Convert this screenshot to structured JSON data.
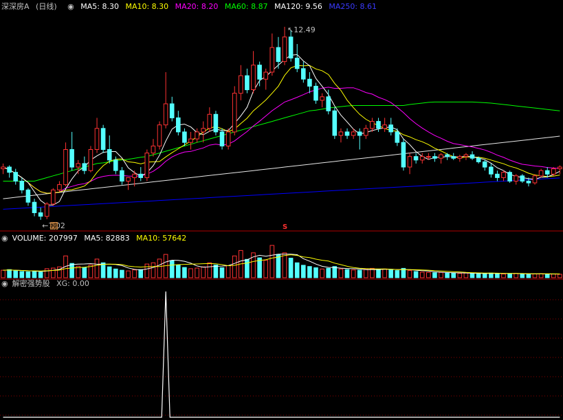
{
  "price_panel": {
    "title": "深深房A",
    "period": "(日线)",
    "ma": [
      {
        "label": "MA5: 8.30",
        "color": "#ffffff"
      },
      {
        "label": "MA10: 8.30",
        "color": "#ffff00"
      },
      {
        "label": "MA20: 8.20",
        "color": "#ff00ff"
      },
      {
        "label": "MA60: 8.87",
        "color": "#00ff00"
      },
      {
        "label": "MA120: 9.56",
        "color": "#ffffff"
      },
      {
        "label": "MA250: 8.61",
        "color": "#0000ff"
      }
    ],
    "high_label": "12.49",
    "low_label": "7.02",
    "marker_bang": "榜",
    "marker_s": "S"
  },
  "volume_panel": {
    "title": "VOLUME: 207997",
    "ma5": "MA5: 82883",
    "ma10": "MA10: 57642"
  },
  "indicator_panel": {
    "title": "解密强势股",
    "xg": "XG: 0.00"
  },
  "colors": {
    "up": "#ff3232",
    "down": "#54ffff",
    "grid": "#8b0000",
    "ma5": "#ffffff",
    "ma10": "#ffff00",
    "ma20": "#ff00ff",
    "ma60": "#00ff00",
    "ma120": "#e8e8e8",
    "ma250": "#0000ff"
  },
  "chart_data": {
    "type": "candlestick",
    "price_ylim": [
      6.8,
      12.9
    ],
    "volume_ylim": [
      0,
      230000
    ],
    "candles": [
      [
        8.45,
        8.6,
        8.3,
        8.5
      ],
      [
        8.5,
        8.55,
        8.2,
        8.35
      ],
      [
        8.35,
        8.45,
        8.0,
        8.1
      ],
      [
        8.1,
        8.2,
        7.75,
        7.85
      ],
      [
        7.85,
        7.9,
        7.4,
        7.5
      ],
      [
        7.5,
        7.6,
        7.1,
        7.2
      ],
      [
        7.2,
        7.35,
        7.0,
        7.1
      ],
      [
        7.1,
        7.5,
        7.02,
        7.45
      ],
      [
        7.45,
        7.9,
        7.4,
        7.85
      ],
      [
        7.85,
        8.1,
        7.8,
        8.0
      ],
      [
        8.0,
        9.2,
        7.95,
        9.0
      ],
      [
        9.0,
        9.5,
        8.4,
        8.5
      ],
      [
        8.5,
        8.7,
        8.3,
        8.6
      ],
      [
        8.6,
        8.8,
        8.3,
        8.4
      ],
      [
        8.4,
        9.1,
        8.35,
        9.0
      ],
      [
        9.0,
        9.9,
        8.9,
        9.6
      ],
      [
        9.6,
        9.7,
        8.9,
        9.0
      ],
      [
        9.0,
        9.4,
        8.6,
        8.7
      ],
      [
        8.7,
        8.8,
        8.3,
        8.4
      ],
      [
        8.4,
        8.5,
        8.0,
        8.1
      ],
      [
        8.1,
        8.2,
        7.85,
        8.2
      ],
      [
        8.2,
        8.4,
        7.95,
        8.3
      ],
      [
        8.3,
        8.5,
        8.1,
        8.2
      ],
      [
        8.2,
        9.0,
        8.1,
        8.9
      ],
      [
        8.9,
        9.3,
        8.8,
        9.1
      ],
      [
        9.1,
        9.8,
        9.0,
        9.7
      ],
      [
        9.7,
        11.2,
        9.6,
        10.3
      ],
      [
        10.3,
        10.5,
        9.8,
        9.9
      ],
      [
        9.9,
        10.1,
        9.4,
        9.5
      ],
      [
        9.5,
        9.6,
        9.1,
        9.2
      ],
      [
        9.2,
        9.5,
        9.0,
        9.3
      ],
      [
        9.3,
        9.6,
        9.2,
        9.5
      ],
      [
        9.5,
        9.8,
        9.2,
        9.6
      ],
      [
        9.6,
        10.2,
        9.5,
        10.0
      ],
      [
        10.0,
        10.1,
        9.4,
        9.5
      ],
      [
        9.5,
        9.6,
        9.0,
        9.1
      ],
      [
        9.1,
        9.6,
        9.0,
        9.5
      ],
      [
        9.5,
        10.8,
        9.4,
        10.6
      ],
      [
        10.6,
        11.4,
        10.4,
        11.1
      ],
      [
        11.1,
        11.3,
        10.6,
        10.7
      ],
      [
        10.7,
        11.8,
        10.6,
        11.4
      ],
      [
        11.4,
        11.5,
        10.8,
        11.0
      ],
      [
        11.0,
        11.3,
        10.7,
        11.2
      ],
      [
        11.2,
        12.3,
        11.1,
        11.9
      ],
      [
        11.9,
        12.2,
        11.3,
        11.5
      ],
      [
        11.5,
        12.49,
        11.4,
        12.2
      ],
      [
        12.2,
        12.4,
        11.5,
        11.6
      ],
      [
        11.6,
        12.0,
        11.2,
        11.3
      ],
      [
        11.3,
        11.5,
        10.9,
        11.0
      ],
      [
        11.0,
        11.2,
        10.6,
        10.8
      ],
      [
        10.8,
        10.9,
        10.3,
        10.4
      ],
      [
        10.4,
        10.6,
        10.2,
        10.5
      ],
      [
        10.5,
        10.7,
        10.0,
        10.1
      ],
      [
        10.1,
        10.2,
        9.3,
        9.4
      ],
      [
        9.4,
        9.6,
        9.2,
        9.5
      ],
      [
        9.5,
        9.6,
        9.3,
        9.4
      ],
      [
        9.4,
        9.6,
        9.3,
        9.5
      ],
      [
        9.5,
        9.6,
        9.0,
        9.4
      ],
      [
        9.4,
        9.7,
        9.3,
        9.6
      ],
      [
        9.6,
        9.9,
        9.5,
        9.8
      ],
      [
        9.8,
        9.9,
        9.5,
        9.6
      ],
      [
        9.6,
        9.9,
        9.5,
        9.7
      ],
      [
        9.7,
        9.9,
        9.4,
        9.5
      ],
      [
        9.5,
        9.6,
        9.1,
        9.2
      ],
      [
        9.2,
        9.3,
        8.4,
        8.5
      ],
      [
        8.5,
        8.9,
        8.3,
        8.8
      ],
      [
        8.8,
        8.9,
        8.6,
        8.7
      ],
      [
        8.7,
        8.9,
        8.6,
        8.8
      ],
      [
        8.8,
        8.9,
        8.7,
        8.8
      ],
      [
        8.8,
        8.9,
        8.65,
        8.75
      ],
      [
        8.75,
        8.9,
        8.6,
        8.85
      ],
      [
        8.85,
        8.9,
        8.7,
        8.8
      ],
      [
        8.8,
        8.9,
        8.7,
        8.75
      ],
      [
        8.75,
        8.85,
        8.65,
        8.8
      ],
      [
        8.8,
        8.9,
        8.7,
        8.85
      ],
      [
        8.85,
        8.95,
        8.7,
        8.75
      ],
      [
        8.75,
        8.8,
        8.6,
        8.65
      ],
      [
        8.65,
        8.7,
        8.4,
        8.5
      ],
      [
        8.5,
        8.6,
        8.2,
        8.3
      ],
      [
        8.3,
        8.4,
        8.1,
        8.2
      ],
      [
        8.2,
        8.4,
        8.1,
        8.35
      ],
      [
        8.35,
        8.4,
        8.05,
        8.1
      ],
      [
        8.1,
        8.3,
        8.0,
        8.25
      ],
      [
        8.25,
        8.3,
        8.05,
        8.1
      ],
      [
        8.1,
        8.2,
        7.95,
        8.05
      ],
      [
        8.05,
        8.3,
        8.0,
        8.25
      ],
      [
        8.25,
        8.45,
        8.2,
        8.4
      ],
      [
        8.4,
        8.5,
        8.2,
        8.3
      ],
      [
        8.3,
        8.5,
        8.25,
        8.45
      ],
      [
        8.45,
        8.55,
        8.3,
        8.5
      ]
    ],
    "volumes": [
      48,
      52,
      45,
      40,
      38,
      42,
      36,
      58,
      62,
      70,
      140,
      92,
      74,
      66,
      82,
      120,
      96,
      70,
      56,
      48,
      44,
      50,
      52,
      88,
      96,
      120,
      150,
      110,
      82,
      66,
      58,
      62,
      70,
      96,
      82,
      64,
      78,
      140,
      175,
      118,
      160,
      128,
      112,
      208,
      150,
      160,
      126,
      96,
      80,
      72,
      64,
      56,
      60,
      72,
      56,
      52,
      50,
      48,
      54,
      60,
      52,
      56,
      50,
      46,
      60,
      46,
      40,
      36,
      34,
      32,
      34,
      30,
      30,
      28,
      30,
      28,
      26,
      28,
      30,
      26,
      24,
      26,
      28,
      24,
      22,
      24,
      26,
      24,
      24,
      22
    ],
    "volume_ma5": 82883,
    "volume_ma10": 57642,
    "xg": [
      0,
      0,
      0,
      0,
      0,
      0,
      0,
      0,
      0,
      0,
      0,
      0,
      0,
      0,
      0,
      0,
      0,
      0,
      0,
      0,
      0,
      0,
      0,
      0,
      0,
      0,
      1,
      0,
      0,
      0,
      0,
      0,
      0,
      0,
      0,
      0,
      0,
      0,
      0,
      0,
      0,
      0,
      0,
      0,
      0,
      0,
      0,
      0,
      0,
      0,
      0,
      0,
      0,
      0,
      0,
      0,
      0,
      0,
      0,
      0,
      0,
      0,
      0,
      0,
      0,
      0,
      0,
      0,
      0,
      0,
      0,
      0,
      0,
      0,
      0,
      0,
      0,
      0,
      0,
      0,
      0,
      0,
      0,
      0,
      0,
      0,
      0,
      0,
      0,
      0
    ],
    "ma60": [
      8.1,
      8.1,
      8.1,
      8.1,
      8.1,
      8.1,
      8.15,
      8.2,
      8.25,
      8.3,
      8.35,
      8.4,
      8.45,
      8.5,
      8.55,
      8.6,
      8.62,
      8.65,
      8.68,
      8.7,
      8.72,
      8.75,
      8.78,
      8.8,
      8.85,
      8.9,
      8.95,
      9.0,
      9.05,
      9.1,
      9.15,
      9.2,
      9.25,
      9.3,
      9.35,
      9.4,
      9.45,
      9.5,
      9.55,
      9.6,
      9.65,
      9.7,
      9.75,
      9.8,
      9.85,
      9.9,
      9.95,
      10.0,
      10.05,
      10.1,
      10.12,
      10.15,
      10.18,
      10.2,
      10.22,
      10.24,
      10.25,
      10.25,
      10.25,
      10.25,
      10.25,
      10.25,
      10.25,
      10.25,
      10.25,
      10.28,
      10.3,
      10.32,
      10.34,
      10.35,
      10.35,
      10.35,
      10.35,
      10.35,
      10.35,
      10.35,
      10.34,
      10.33,
      10.32,
      10.3,
      10.28,
      10.26,
      10.24,
      10.22,
      10.2,
      10.18,
      10.16,
      10.14,
      10.12,
      10.1
    ],
    "ma120": [
      7.6,
      7.62,
      7.64,
      7.66,
      7.68,
      7.7,
      7.72,
      7.74,
      7.76,
      7.78,
      7.8,
      7.82,
      7.84,
      7.86,
      7.88,
      7.9,
      7.92,
      7.94,
      7.96,
      7.98,
      8.0,
      8.02,
      8.04,
      8.06,
      8.08,
      8.1,
      8.12,
      8.14,
      8.16,
      8.18,
      8.2,
      8.22,
      8.24,
      8.26,
      8.28,
      8.3,
      8.32,
      8.34,
      8.36,
      8.38,
      8.4,
      8.42,
      8.44,
      8.46,
      8.48,
      8.5,
      8.52,
      8.54,
      8.56,
      8.58,
      8.6,
      8.62,
      8.64,
      8.66,
      8.68,
      8.7,
      8.72,
      8.74,
      8.76,
      8.78,
      8.8,
      8.82,
      8.84,
      8.86,
      8.88,
      8.9,
      8.92,
      8.94,
      8.96,
      8.98,
      9.0,
      9.02,
      9.04,
      9.06,
      9.08,
      9.1,
      9.12,
      9.14,
      9.16,
      9.18,
      9.2,
      9.22,
      9.24,
      9.26,
      9.28,
      9.3,
      9.32,
      9.34,
      9.36,
      9.38
    ],
    "ma250": [
      7.3,
      7.31,
      7.32,
      7.33,
      7.34,
      7.35,
      7.36,
      7.37,
      7.38,
      7.39,
      7.4,
      7.41,
      7.42,
      7.43,
      7.44,
      7.45,
      7.46,
      7.47,
      7.48,
      7.49,
      7.5,
      7.51,
      7.52,
      7.53,
      7.54,
      7.55,
      7.56,
      7.57,
      7.58,
      7.59,
      7.6,
      7.61,
      7.62,
      7.63,
      7.64,
      7.65,
      7.66,
      7.67,
      7.68,
      7.69,
      7.7,
      7.71,
      7.72,
      7.73,
      7.74,
      7.75,
      7.76,
      7.77,
      7.78,
      7.79,
      7.8,
      7.81,
      7.82,
      7.83,
      7.84,
      7.85,
      7.86,
      7.87,
      7.88,
      7.89,
      7.9,
      7.91,
      7.92,
      7.93,
      7.94,
      7.95,
      7.96,
      7.97,
      7.98,
      7.99,
      8.0,
      8.01,
      8.02,
      8.03,
      8.04,
      8.05,
      8.06,
      8.07,
      8.08,
      8.09,
      8.1,
      8.11,
      8.12,
      8.13,
      8.14,
      8.15,
      8.16,
      8.17,
      8.18,
      8.19
    ]
  }
}
